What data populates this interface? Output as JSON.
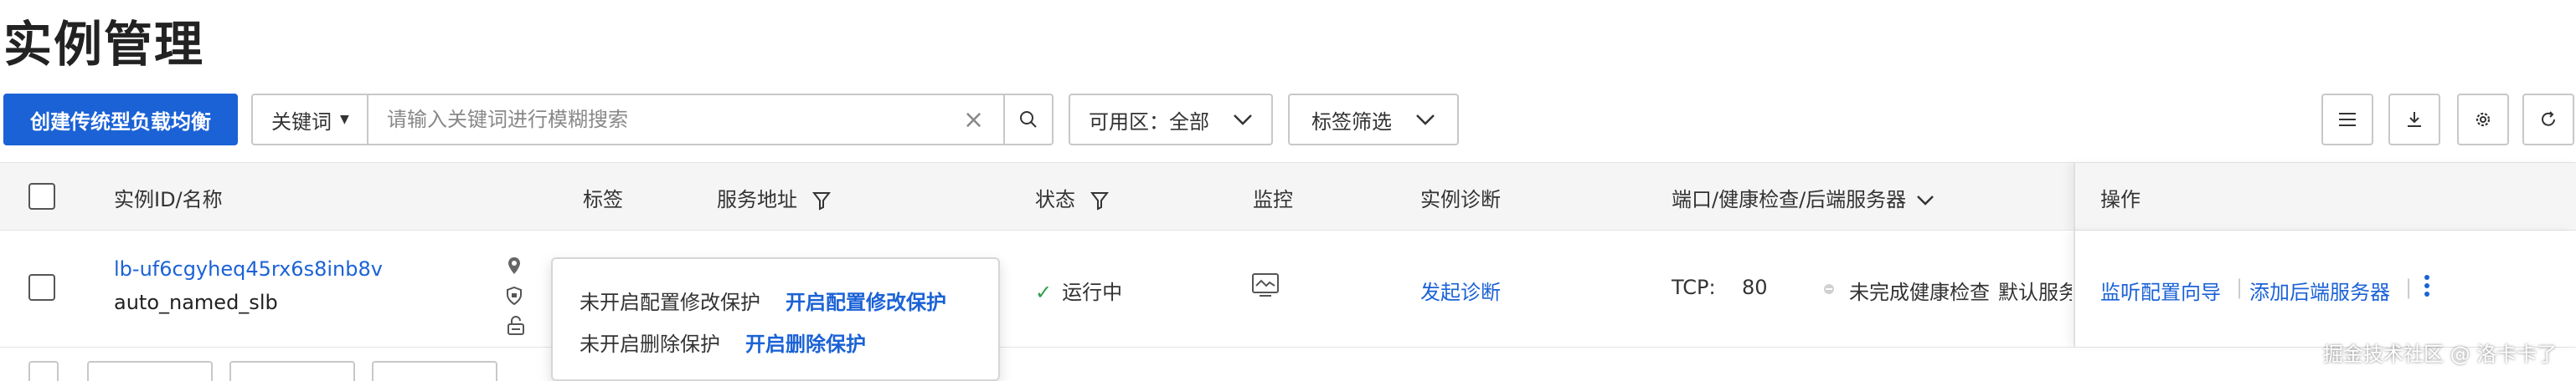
{
  "page": {
    "title": "实例管理"
  },
  "toolbar": {
    "create_label": "创建传统型负载均衡",
    "search_key": "关键词",
    "search_placeholder": "请输入关键词进行模糊搜索",
    "zone_label": "可用区：",
    "zone_value": "全部",
    "tag_filter_label": "标签筛选"
  },
  "table": {
    "headers": {
      "id_name": "实例ID/名称",
      "tags": "标签",
      "address": "服务地址",
      "status": "状态",
      "monitor": "监控",
      "diagnosis": "实例诊断",
      "ports": "端口/健康检查/后端服务器",
      "ops": "操作"
    },
    "row": {
      "instance_id": "lb-uf6cgyheq45rx6s8inb8v",
      "instance_name": "auto_named_slb",
      "status": "运行中",
      "diagnosis_link": "发起诊断",
      "protocol": "TCP:",
      "port": "80",
      "health": "未完成健康检查",
      "backend": "默认服务",
      "op_listener": "监听配置向导",
      "op_add_backend": "添加后端服务器"
    }
  },
  "popover": {
    "config_status": "未开启配置修改保护",
    "config_link": "开启配置修改保护",
    "delete_status": "未开启删除保护",
    "delete_link": "开启删除保护"
  },
  "watermark": "掘金技术社区 @ 洛卡卡了",
  "colors": {
    "primary": "#1b62d6",
    "status_ok": "#2e9e4a"
  }
}
